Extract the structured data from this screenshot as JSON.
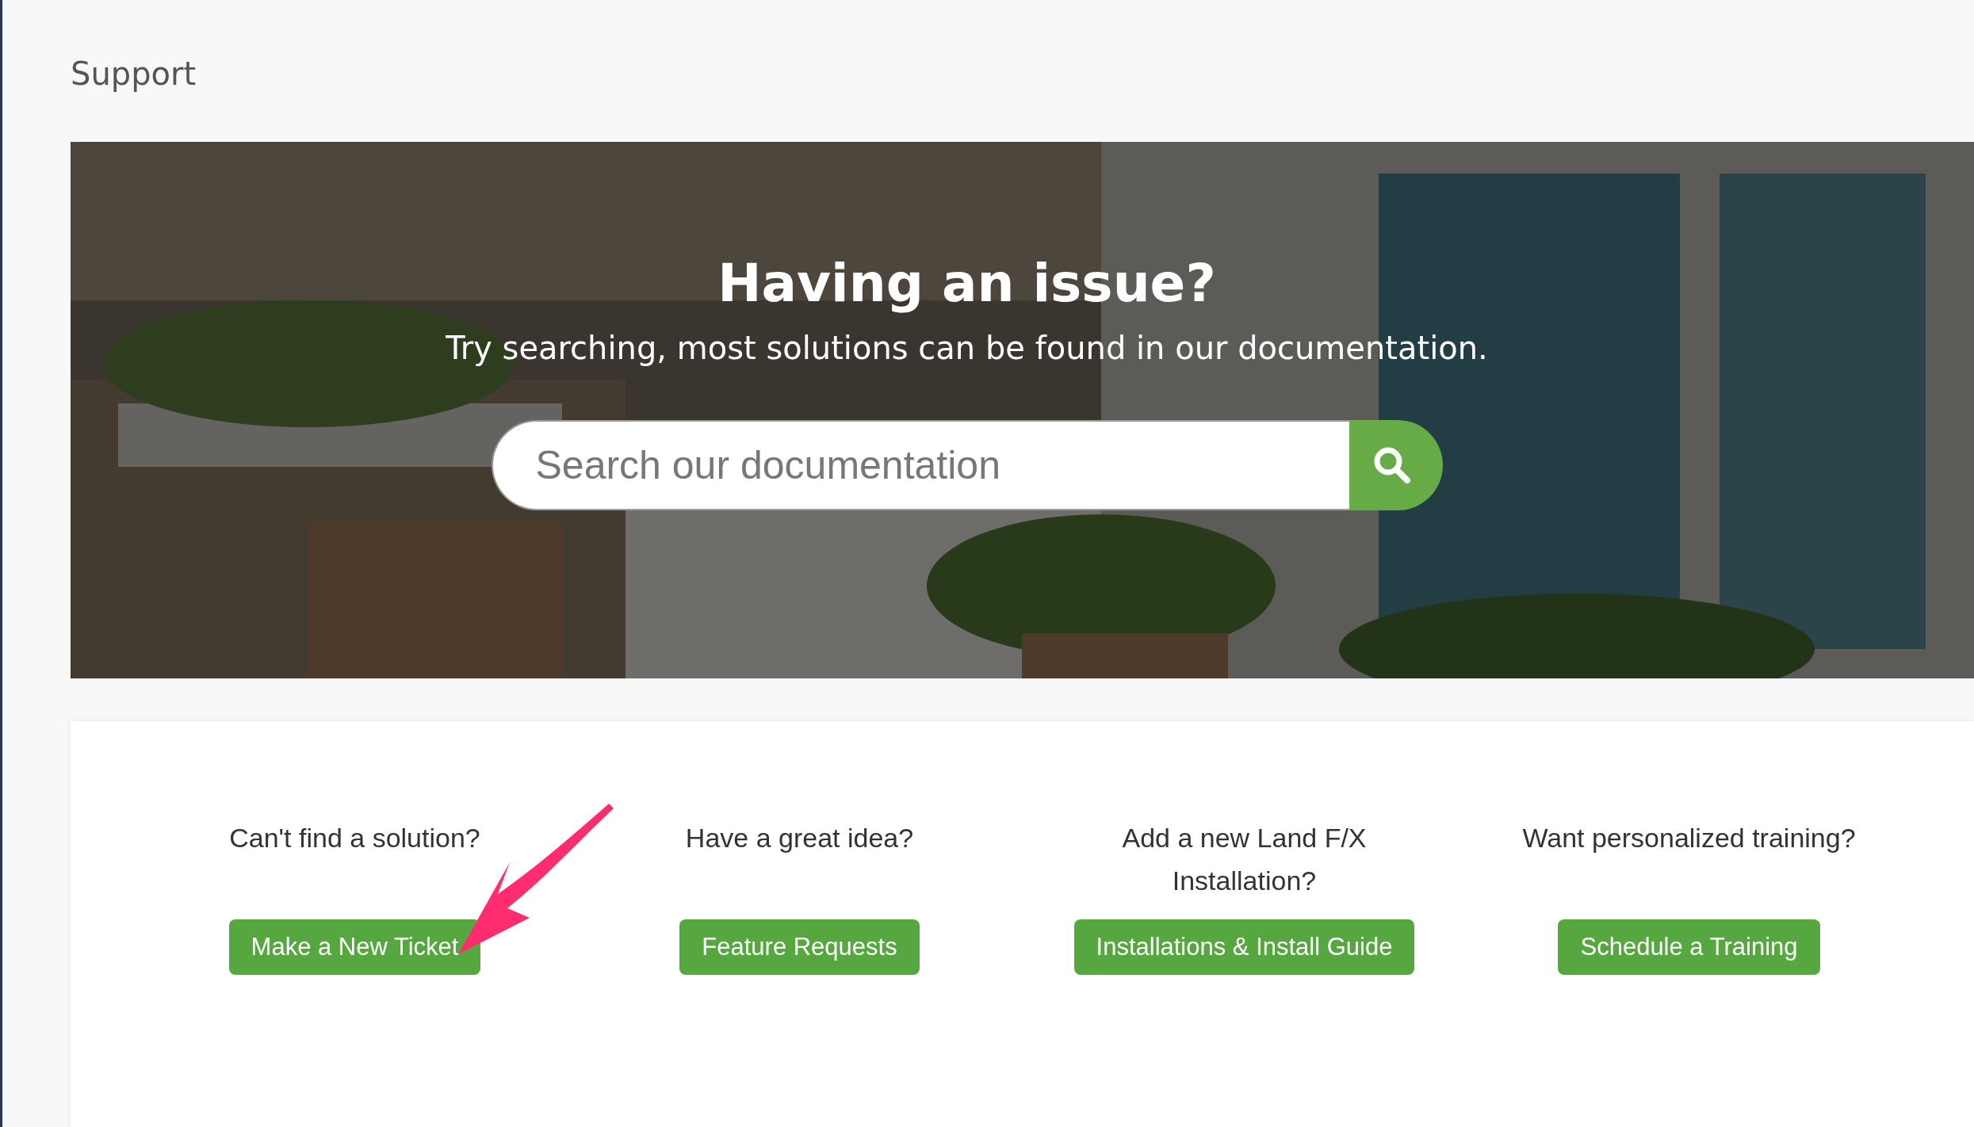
{
  "page_title": "Support",
  "hero": {
    "kind": "picture",
    "title": "Having an issue?",
    "subtitle": "Try searching, most solutions can be found in our documentation.",
    "search": {
      "placeholder": "Search our documentation"
    }
  },
  "actions": [
    {
      "prompt": "Can't find a solution?",
      "button": "Make a New Ticket"
    },
    {
      "prompt": "Have a great idea?",
      "button": "Feature Requests"
    },
    {
      "prompt": "Add a new Land F/X Installation?",
      "button": "Installations & Install Guide"
    },
    {
      "prompt": "Want personalized training?",
      "button": "Schedule a Training"
    }
  ],
  "annotation": {
    "kind": "arrow",
    "color": "#ff2d6f"
  }
}
